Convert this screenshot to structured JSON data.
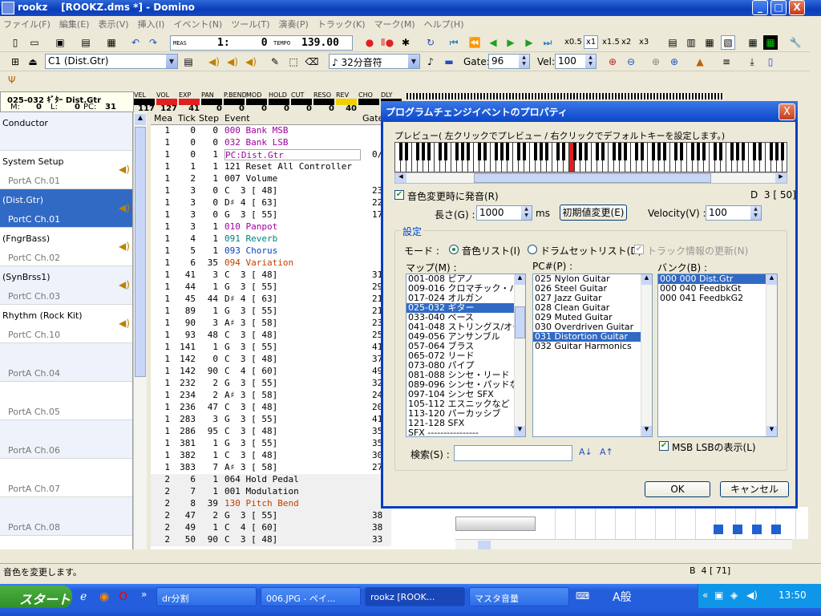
{
  "window": {
    "title": "rookz    [ROOKZ.dms *] - Domino",
    "minimize": "_",
    "maximize": "□",
    "close": "X"
  },
  "menu": [
    "ファイル(F)",
    "編集(E)",
    "表示(V)",
    "挿入(I)",
    "イベント(N)",
    "ツール(T)",
    "演奏(P)",
    "トラック(K)",
    "マーク(M)",
    "ヘルプ(H)"
  ],
  "toolbar1": {
    "meas_label": "MEAS",
    "meas_value": "1:     0",
    "tempo_label": "TEMPO",
    "tempo_value": "139.00",
    "zoom": [
      "x0.5",
      "x1",
      "x1.5",
      "x2",
      "x3"
    ],
    "zoom_selected": "x1"
  },
  "toolbar2": {
    "track_select": "C1   (Dist.Gtr)",
    "note_select": "♪ 32分音符",
    "gate_label": "Gate:",
    "gate_value": "96",
    "vel_label": "Vel:",
    "vel_value": "100"
  },
  "track_info": {
    "name": "025-032 ｷﾞﾀｰ Dist.Gtr",
    "m_label": "M:",
    "m_value": "0",
    "l_label": "L:",
    "l_value": "0",
    "pc_label": "PC:",
    "pc_value": "31"
  },
  "mixer": [
    {
      "label": "VEL",
      "value": "117",
      "color": "#000000"
    },
    {
      "label": "VOL",
      "value": "127",
      "color": "#e02020"
    },
    {
      "label": "EXP",
      "value": "41",
      "color": "#e02020"
    },
    {
      "label": "PAN",
      "value": "0",
      "color": "#000000"
    },
    {
      "label": "P.BEND",
      "value": "0",
      "color": "#000000"
    },
    {
      "label": "MOD",
      "value": "0",
      "color": "#000000"
    },
    {
      "label": "HOLD",
      "value": "0",
      "color": "#000000"
    },
    {
      "label": "CUT",
      "value": "0",
      "color": "#000000"
    },
    {
      "label": "RESO",
      "value": "0",
      "color": "#000000"
    },
    {
      "label": "REV",
      "value": "40",
      "color": "#f0d000"
    },
    {
      "label": "CHO",
      "value": "",
      "color": "#000000"
    },
    {
      "label": "DLY",
      "value": "",
      "color": "#000000"
    }
  ],
  "tracks": [
    {
      "name": "Conductor",
      "port": "",
      "selected": false
    },
    {
      "name": "System Setup",
      "port": "PortA  Ch.01",
      "selected": false
    },
    {
      "name": "(Dist.Gtr)",
      "port": "PortC  Ch.01",
      "selected": true
    },
    {
      "name": "(FngrBass)",
      "port": "PortC  Ch.02",
      "selected": false
    },
    {
      "name": "(SynBrss1)",
      "port": "PortC  Ch.03",
      "selected": false
    },
    {
      "name": "Rhythm (Rock Kit)",
      "port": "PortC  Ch.10",
      "selected": false
    },
    {
      "name": "",
      "port": "PortA  Ch.04",
      "selected": false
    },
    {
      "name": "",
      "port": "PortA  Ch.05",
      "selected": false
    },
    {
      "name": "",
      "port": "PortA  Ch.06",
      "selected": false
    },
    {
      "name": "",
      "port": "PortA  Ch.07",
      "selected": false
    },
    {
      "name": "",
      "port": "PortA  Ch.08",
      "selected": false
    }
  ],
  "event_header": {
    "mea": "Mea",
    "tick": "Tick",
    "step": "Step",
    "event": "Event",
    "gate": "Gate"
  },
  "events": [
    {
      "mea": "1",
      "tick": "0",
      "step": "0",
      "event": "000 Bank MSB",
      "gate": "",
      "vel": "",
      "color": "#a000a0"
    },
    {
      "mea": "1",
      "tick": "0",
      "step": "0",
      "event": "032 Bank LSB",
      "gate": "",
      "vel": "",
      "color": "#a000a0"
    },
    {
      "mea": "1",
      "tick": "0",
      "step": "1",
      "event": "PC:Dist.Gtr",
      "gate": "0/0",
      "vel": "",
      "color": "#a000a0"
    },
    {
      "mea": "1",
      "tick": "1",
      "step": "1",
      "event": "121 Reset All Controller",
      "gate": "",
      "vel": "",
      "color": "#000000"
    },
    {
      "mea": "1",
      "tick": "2",
      "step": "1",
      "event": "007 Volume",
      "gate": "",
      "vel": "",
      "color": "#000000"
    },
    {
      "mea": "1",
      "tick": "3",
      "step": "0",
      "event": "C  3 [ 48]",
      "gate": "23",
      "vel": "",
      "color": "#000000"
    },
    {
      "mea": "1",
      "tick": "3",
      "step": "0",
      "event": "D♯ 4 [ 63]",
      "gate": "22",
      "vel": "",
      "color": "#000000"
    },
    {
      "mea": "1",
      "tick": "3",
      "step": "0",
      "event": "G  3 [ 55]",
      "gate": "17",
      "vel": "",
      "color": "#000000"
    },
    {
      "mea": "1",
      "tick": "3",
      "step": "1",
      "event": "010 Panpot",
      "gate": "",
      "vel": "",
      "color": "#a000a0"
    },
    {
      "mea": "1",
      "tick": "4",
      "step": "1",
      "event": "091 Reverb",
      "gate": "",
      "vel": "",
      "color": "#008080"
    },
    {
      "mea": "1",
      "tick": "5",
      "step": "1",
      "event": "093 Chorus",
      "gate": "",
      "vel": "",
      "color": "#0040c0"
    },
    {
      "mea": "1",
      "tick": "6",
      "step": "35",
      "event": "094 Variation",
      "gate": "",
      "vel": "",
      "color": "#c04000"
    },
    {
      "mea": "1",
      "tick": "41",
      "step": "3",
      "event": "C  3 [ 48]",
      "gate": "31",
      "vel": "",
      "color": "#000000"
    },
    {
      "mea": "1",
      "tick": "44",
      "step": "1",
      "event": "G  3 [ 55]",
      "gate": "29",
      "vel": "",
      "color": "#000000"
    },
    {
      "mea": "1",
      "tick": "45",
      "step": "44",
      "event": "D♯ 4 [ 63]",
      "gate": "21",
      "vel": "",
      "color": "#000000"
    },
    {
      "mea": "1",
      "tick": "89",
      "step": "1",
      "event": "G  3 [ 55]",
      "gate": "21",
      "vel": "",
      "color": "#000000"
    },
    {
      "mea": "1",
      "tick": "90",
      "step": "3",
      "event": "A♯ 3 [ 58]",
      "gate": "23",
      "vel": "",
      "color": "#000000"
    },
    {
      "mea": "1",
      "tick": "93",
      "step": "48",
      "event": "C  3 [ 48]",
      "gate": "25",
      "vel": "",
      "color": "#000000"
    },
    {
      "mea": "1",
      "tick": "141",
      "step": "1",
      "event": "G  3 [ 55]",
      "gate": "41",
      "vel": "",
      "color": "#000000"
    },
    {
      "mea": "1",
      "tick": "142",
      "step": "0",
      "event": "C  3 [ 48]",
      "gate": "37",
      "vel": "",
      "color": "#000000"
    },
    {
      "mea": "1",
      "tick": "142",
      "step": "90",
      "event": "C  4 [ 60]",
      "gate": "49",
      "vel": "",
      "color": "#000000"
    },
    {
      "mea": "1",
      "tick": "232",
      "step": "2",
      "event": "G  3 [ 55]",
      "gate": "32",
      "vel": "",
      "color": "#000000"
    },
    {
      "mea": "1",
      "tick": "234",
      "step": "2",
      "event": "A♯ 3 [ 58]",
      "gate": "24",
      "vel": "",
      "color": "#000000"
    },
    {
      "mea": "1",
      "tick": "236",
      "step": "47",
      "event": "C  3 [ 48]",
      "gate": "20",
      "vel": "",
      "color": "#000000"
    },
    {
      "mea": "1",
      "tick": "283",
      "step": "3",
      "event": "G  3 [ 55]",
      "gate": "41",
      "vel": "",
      "color": "#000000"
    },
    {
      "mea": "1",
      "tick": "286",
      "step": "95",
      "event": "C  3 [ 48]",
      "gate": "35",
      "vel": "",
      "color": "#000000"
    },
    {
      "mea": "1",
      "tick": "381",
      "step": "1",
      "event": "G  3 [ 55]",
      "gate": "35",
      "vel": "",
      "color": "#000000"
    },
    {
      "mea": "1",
      "tick": "382",
      "step": "1",
      "event": "C  3 [ 48]",
      "gate": "30",
      "vel": "",
      "color": "#000000"
    },
    {
      "mea": "1",
      "tick": "383",
      "step": "7",
      "event": "A♯ 3 [ 58]",
      "gate": "27",
      "vel": "",
      "color": "#000000"
    },
    {
      "mea": "2",
      "tick": "6",
      "step": "1",
      "event": "064 Hold Pedal",
      "gate": "",
      "vel": "",
      "color": "#000000"
    },
    {
      "mea": "2",
      "tick": "7",
      "step": "1",
      "event": "001 Modulation",
      "gate": "",
      "vel": "",
      "color": "#000000"
    },
    {
      "mea": "2",
      "tick": "8",
      "step": "39",
      "event": "130 Pitch Bend",
      "gate": "",
      "vel": "",
      "color": "#c04000"
    },
    {
      "mea": "2",
      "tick": "47",
      "step": "2",
      "event": "G  3 [ 55]",
      "gate": "38",
      "vel": "127",
      "color": "#000000"
    },
    {
      "mea": "2",
      "tick": "49",
      "step": "1",
      "event": "C  4 [ 60]",
      "gate": "38",
      "vel": "127",
      "color": "#000000"
    },
    {
      "mea": "2",
      "tick": "50",
      "step": "90",
      "event": "C  3 [ 48]",
      "gate": "33",
      "vel": "127",
      "color": "#000000"
    }
  ],
  "status": {
    "left": "音色を変更します。",
    "right": "B  4 [ 71]"
  },
  "taskbar": {
    "start": "スタート",
    "tasks": [
      "dr分割",
      "006.JPG - ペイ...",
      "rookz    [ROOK...",
      "マスタ音量"
    ],
    "active": 2,
    "ime": "A般",
    "clock": "13:50"
  },
  "dialog": {
    "title": "プログラムチェンジイベントのプロパティ",
    "preview_label": "プレビュー( 左クリックでプレビュー / 右クリックでデフォルトキーを設定します。)",
    "sound_on_change": "音色変更時に発音(R)",
    "sound_on_change_checked": true,
    "key_readout": "D  3 [ 50]",
    "length_label": "長さ(G) :",
    "length_value": "1000",
    "length_unit": "ms",
    "reset_button": "初期値変更(E)",
    "velocity_label": "Velocity(V) :",
    "velocity_value": "100",
    "settings_label": "設定",
    "mode_label": "モード :",
    "mode_options": [
      "音色リスト(I)",
      "ドラムセットリスト(D)"
    ],
    "mode_selected": 0,
    "track_update": "トラック情報の更新(N)",
    "map_label": "マップ(M) :",
    "pc_label": "PC#(P) :",
    "bank_label": "バンク(B) :",
    "map_items": [
      "001-008 ピアノ",
      "009-016 クロマチック・パーカッシ",
      "017-024 オルガン",
      "025-032 ギター",
      "033-040 ベース",
      "041-048 ストリングス/オーケス",
      "049-056 アンサンブル",
      "057-064 ブラス",
      "065-072 リード",
      "073-080 パイプ",
      "081-088 シンセ・リード",
      "089-096 シンセ・パッドなど",
      "097-104 シンセ SFX",
      "105-112 エスニックなど",
      "113-120 パーカッシブ",
      "121-128 SFX",
      "SFX ----------------"
    ],
    "map_selected": 3,
    "pc_items": [
      "025 Nylon Guitar",
      "026 Steel Guitar",
      "027 Jazz Guitar",
      "028 Clean Guitar",
      "029 Muted Guitar",
      "030 Overdriven Guitar",
      "031 Distortion Guitar",
      "032 Guitar Harmonics"
    ],
    "pc_selected": 6,
    "bank_items": [
      "000 000 Dist.Gtr",
      "000 040 FeedbkGt",
      "000 041 FeedbkG2"
    ],
    "bank_selected": 0,
    "msb_lsb_label": "MSB LSBの表示(L)",
    "msb_lsb_checked": true,
    "search_label": "検索(S) :",
    "search_value": "",
    "ok": "OK",
    "cancel": "キャンセル",
    "highlight_color": "#e02020",
    "close": "X"
  }
}
